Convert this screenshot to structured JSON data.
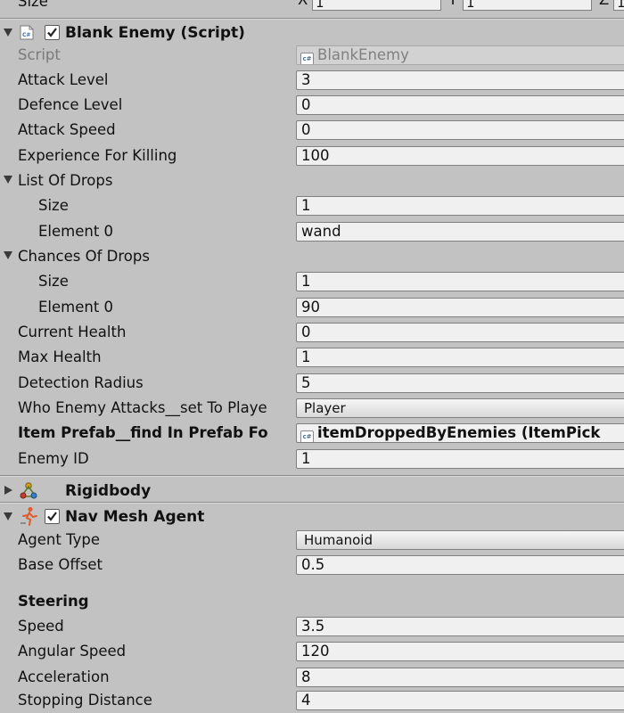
{
  "top_row": {
    "label": "Size",
    "x_axis": "X",
    "x_value": "1",
    "y_axis": "Y",
    "y_value": "1",
    "z_axis": "Z",
    "z_value": "1"
  },
  "blank_enemy": {
    "title": "Blank Enemy (Script)",
    "icon": "csharp-script-icon",
    "script_label": "Script",
    "script_value": "BlankEnemy",
    "attack_level_label": "Attack Level",
    "attack_level": "3",
    "defence_level_label": "Defence Level",
    "defence_level": "0",
    "attack_speed_label": "Attack Speed",
    "attack_speed": "0",
    "experience_label": "Experience For Killing",
    "experience": "100",
    "list_of_drops": {
      "label": "List Of Drops",
      "size_label": "Size",
      "size": "1",
      "element0_label": "Element 0",
      "element0": "wand"
    },
    "chances_of_drops": {
      "label": "Chances Of Drops",
      "size_label": "Size",
      "size": "1",
      "element0_label": "Element 0",
      "element0": "90"
    },
    "current_health_label": "Current Health",
    "current_health": "0",
    "max_health_label": "Max Health",
    "max_health": "1",
    "detection_radius_label": "Detection Radius",
    "detection_radius": "5",
    "who_attacks_label": "Who Enemy Attacks__set To Playe",
    "who_attacks": "Player",
    "item_prefab_label": "Item Prefab__find In Prefab Fo",
    "item_prefab": "itemDroppedByEnemies (ItemPick",
    "enemy_id_label": "Enemy ID",
    "enemy_id": "1"
  },
  "rigidbody": {
    "title": "Rigidbody",
    "icon": "rigidbody-icon"
  },
  "nav_mesh_agent": {
    "title": "Nav Mesh Agent",
    "icon": "nav-agent-icon",
    "agent_type_label": "Agent Type",
    "agent_type": "Humanoid",
    "base_offset_label": "Base Offset",
    "base_offset": "0.5",
    "steering_heading": "Steering",
    "speed_label": "Speed",
    "speed": "3.5",
    "angular_speed_label": "Angular Speed",
    "angular_speed": "120",
    "acceleration_label": "Acceleration",
    "acceleration": "8",
    "stopping_distance_label": "Stopping Distance",
    "stopping_distance": "4"
  },
  "colors": {
    "panel_bg": "#c2c2c2",
    "field_bg": "#f0f0f0",
    "field_border": "#7f7f7f"
  }
}
